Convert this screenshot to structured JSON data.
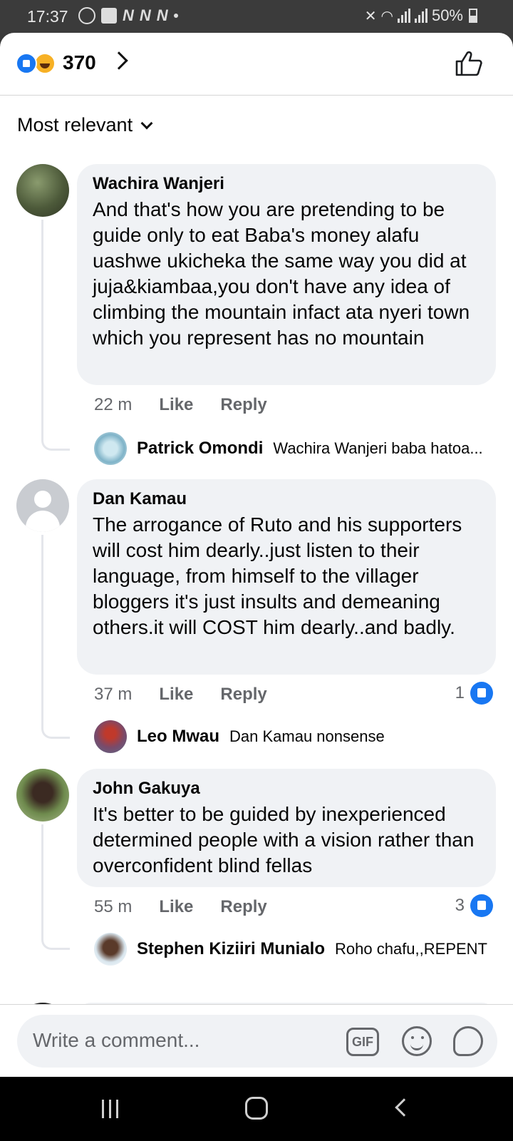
{
  "status_bar": {
    "time": "17:37",
    "notif_letters": [
      "N",
      "N",
      "N"
    ],
    "battery": "50%"
  },
  "header": {
    "reaction_count": "370",
    "reactions": [
      "like-icon",
      "haha-icon"
    ]
  },
  "sort": {
    "label": "Most relevant"
  },
  "comments": [
    {
      "author": "Wachira Wanjeri",
      "text": "And that's how you are pretending to be guide only to eat Baba's money alafu uashwe ukicheka the same way you did at juja&kiambaa,you don't have any idea of climbing the mountain infact ata nyeri town which you represent has no mountain",
      "time": "22 m",
      "like_label": "Like",
      "reply_label": "Reply",
      "likes": "",
      "reply": {
        "author": "Patrick Omondi",
        "text": "Wachira Wanjeri baba hatoa..."
      }
    },
    {
      "author": "Dan Kamau",
      "text": "The arrogance of Ruto and his supporters will cost him dearly..just listen to their language, from himself to the villager bloggers it's just insults and demeaning others.it will COST him dearly..and badly.",
      "time": "37 m",
      "like_label": "Like",
      "reply_label": "Reply",
      "likes": "1",
      "reply": {
        "author": "Leo Mwau",
        "text": "Dan Kamau nonsense"
      }
    },
    {
      "author": "John Gakuya",
      "text": "It's better to be guided by inexperienced determined people with a vision rather than overconfident blind fellas",
      "time": "55 m",
      "like_label": "Like",
      "reply_label": "Reply",
      "likes": "3",
      "reply": {
        "author": "Stephen Kiziiri Munialo",
        "text": "Roho chafu,,REPENT"
      }
    }
  ],
  "composer": {
    "placeholder": "Write a comment...",
    "gif_label": "GIF"
  },
  "colors": {
    "accent": "#1877f2",
    "bubble": "#f0f2f5",
    "secondary_text": "#65676b"
  }
}
